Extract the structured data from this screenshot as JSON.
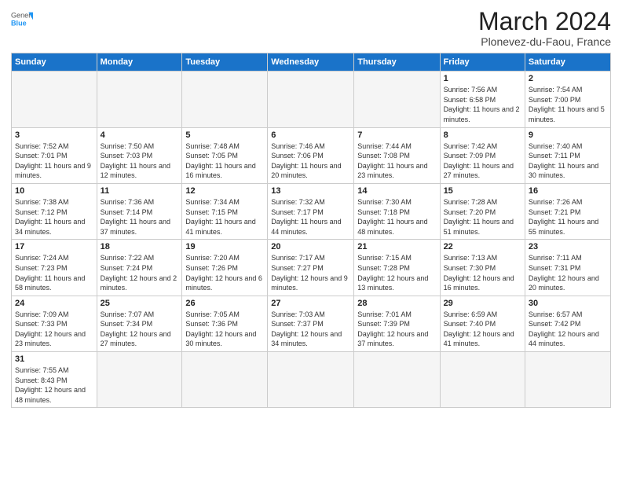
{
  "logo": {
    "general": "General",
    "blue": "Blue"
  },
  "title": "March 2024",
  "subtitle": "Plonevez-du-Faou, France",
  "days_of_week": [
    "Sunday",
    "Monday",
    "Tuesday",
    "Wednesday",
    "Thursday",
    "Friday",
    "Saturday"
  ],
  "weeks": [
    [
      {
        "day": "",
        "info": ""
      },
      {
        "day": "",
        "info": ""
      },
      {
        "day": "",
        "info": ""
      },
      {
        "day": "",
        "info": ""
      },
      {
        "day": "",
        "info": ""
      },
      {
        "day": "1",
        "info": "Sunrise: 7:56 AM\nSunset: 6:58 PM\nDaylight: 11 hours and 2 minutes."
      },
      {
        "day": "2",
        "info": "Sunrise: 7:54 AM\nSunset: 7:00 PM\nDaylight: 11 hours and 5 minutes."
      }
    ],
    [
      {
        "day": "3",
        "info": "Sunrise: 7:52 AM\nSunset: 7:01 PM\nDaylight: 11 hours and 9 minutes."
      },
      {
        "day": "4",
        "info": "Sunrise: 7:50 AM\nSunset: 7:03 PM\nDaylight: 11 hours and 12 minutes."
      },
      {
        "day": "5",
        "info": "Sunrise: 7:48 AM\nSunset: 7:05 PM\nDaylight: 11 hours and 16 minutes."
      },
      {
        "day": "6",
        "info": "Sunrise: 7:46 AM\nSunset: 7:06 PM\nDaylight: 11 hours and 20 minutes."
      },
      {
        "day": "7",
        "info": "Sunrise: 7:44 AM\nSunset: 7:08 PM\nDaylight: 11 hours and 23 minutes."
      },
      {
        "day": "8",
        "info": "Sunrise: 7:42 AM\nSunset: 7:09 PM\nDaylight: 11 hours and 27 minutes."
      },
      {
        "day": "9",
        "info": "Sunrise: 7:40 AM\nSunset: 7:11 PM\nDaylight: 11 hours and 30 minutes."
      }
    ],
    [
      {
        "day": "10",
        "info": "Sunrise: 7:38 AM\nSunset: 7:12 PM\nDaylight: 11 hours and 34 minutes."
      },
      {
        "day": "11",
        "info": "Sunrise: 7:36 AM\nSunset: 7:14 PM\nDaylight: 11 hours and 37 minutes."
      },
      {
        "day": "12",
        "info": "Sunrise: 7:34 AM\nSunset: 7:15 PM\nDaylight: 11 hours and 41 minutes."
      },
      {
        "day": "13",
        "info": "Sunrise: 7:32 AM\nSunset: 7:17 PM\nDaylight: 11 hours and 44 minutes."
      },
      {
        "day": "14",
        "info": "Sunrise: 7:30 AM\nSunset: 7:18 PM\nDaylight: 11 hours and 48 minutes."
      },
      {
        "day": "15",
        "info": "Sunrise: 7:28 AM\nSunset: 7:20 PM\nDaylight: 11 hours and 51 minutes."
      },
      {
        "day": "16",
        "info": "Sunrise: 7:26 AM\nSunset: 7:21 PM\nDaylight: 11 hours and 55 minutes."
      }
    ],
    [
      {
        "day": "17",
        "info": "Sunrise: 7:24 AM\nSunset: 7:23 PM\nDaylight: 11 hours and 58 minutes."
      },
      {
        "day": "18",
        "info": "Sunrise: 7:22 AM\nSunset: 7:24 PM\nDaylight: 12 hours and 2 minutes."
      },
      {
        "day": "19",
        "info": "Sunrise: 7:20 AM\nSunset: 7:26 PM\nDaylight: 12 hours and 6 minutes."
      },
      {
        "day": "20",
        "info": "Sunrise: 7:17 AM\nSunset: 7:27 PM\nDaylight: 12 hours and 9 minutes."
      },
      {
        "day": "21",
        "info": "Sunrise: 7:15 AM\nSunset: 7:28 PM\nDaylight: 12 hours and 13 minutes."
      },
      {
        "day": "22",
        "info": "Sunrise: 7:13 AM\nSunset: 7:30 PM\nDaylight: 12 hours and 16 minutes."
      },
      {
        "day": "23",
        "info": "Sunrise: 7:11 AM\nSunset: 7:31 PM\nDaylight: 12 hours and 20 minutes."
      }
    ],
    [
      {
        "day": "24",
        "info": "Sunrise: 7:09 AM\nSunset: 7:33 PM\nDaylight: 12 hours and 23 minutes."
      },
      {
        "day": "25",
        "info": "Sunrise: 7:07 AM\nSunset: 7:34 PM\nDaylight: 12 hours and 27 minutes."
      },
      {
        "day": "26",
        "info": "Sunrise: 7:05 AM\nSunset: 7:36 PM\nDaylight: 12 hours and 30 minutes."
      },
      {
        "day": "27",
        "info": "Sunrise: 7:03 AM\nSunset: 7:37 PM\nDaylight: 12 hours and 34 minutes."
      },
      {
        "day": "28",
        "info": "Sunrise: 7:01 AM\nSunset: 7:39 PM\nDaylight: 12 hours and 37 minutes."
      },
      {
        "day": "29",
        "info": "Sunrise: 6:59 AM\nSunset: 7:40 PM\nDaylight: 12 hours and 41 minutes."
      },
      {
        "day": "30",
        "info": "Sunrise: 6:57 AM\nSunset: 7:42 PM\nDaylight: 12 hours and 44 minutes."
      }
    ],
    [
      {
        "day": "31",
        "info": "Sunrise: 7:55 AM\nSunset: 8:43 PM\nDaylight: 12 hours and 48 minutes."
      },
      {
        "day": "",
        "info": ""
      },
      {
        "day": "",
        "info": ""
      },
      {
        "day": "",
        "info": ""
      },
      {
        "day": "",
        "info": ""
      },
      {
        "day": "",
        "info": ""
      },
      {
        "day": "",
        "info": ""
      }
    ]
  ]
}
